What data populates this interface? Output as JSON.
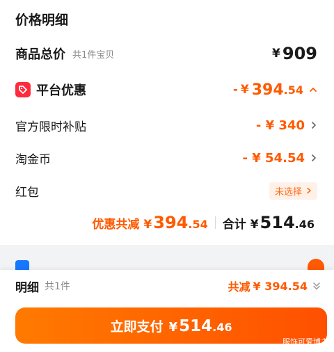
{
  "header": {
    "title": "价格明细"
  },
  "total": {
    "label": "商品总价",
    "sub": "共1件宝贝",
    "currency": "¥",
    "amount": "909"
  },
  "platform": {
    "label": "平台优惠",
    "icon": "tag-icon",
    "prefix": "-",
    "currency": "¥",
    "amount_int": "394",
    "amount_dec": ".54"
  },
  "official": {
    "label": "官方限时补贴",
    "value": "- ¥ 340"
  },
  "coin": {
    "label": "淘金币",
    "value": "- ¥ 54.54"
  },
  "redpack": {
    "label": "红包",
    "badge": "未选择"
  },
  "summary": {
    "discount_label": "优惠共减",
    "discount_currency": "¥",
    "discount_int": "394",
    "discount_dec": ".54",
    "total_label": "合计",
    "total_currency": "¥",
    "total_int": "514",
    "total_dec": ".46"
  },
  "bottom": {
    "label": "明细",
    "sub": "共1件",
    "cut_label": "共减",
    "cut_value": "¥ 394.54",
    "pay_label": "立即支付",
    "pay_currency": "¥",
    "pay_int": "514",
    "pay_dec": ".46"
  },
  "watermark": "服饰可爱博主",
  "colors": {
    "accent": "#ff5a00",
    "tag": "#ff2a3c",
    "alipay": "#1677ff",
    "background_gap": "#f2f3f5"
  }
}
